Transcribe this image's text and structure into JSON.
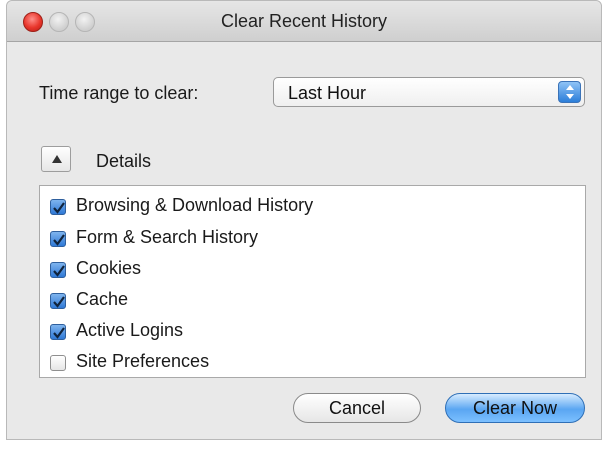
{
  "window": {
    "title": "Clear Recent History"
  },
  "time_range": {
    "label": "Time range to clear:",
    "selected": "Last Hour"
  },
  "details": {
    "label": "Details",
    "expanded": true
  },
  "options": [
    {
      "label": "Browsing & Download History",
      "checked": true
    },
    {
      "label": "Form & Search History",
      "checked": true
    },
    {
      "label": "Cookies",
      "checked": true
    },
    {
      "label": "Cache",
      "checked": true
    },
    {
      "label": "Active Logins",
      "checked": true
    },
    {
      "label": "Site Preferences",
      "checked": false
    }
  ],
  "buttons": {
    "cancel": "Cancel",
    "clear_now": "Clear Now"
  },
  "icons": {
    "close": "close-icon",
    "minimize": "minimize-icon",
    "zoom": "zoom-icon",
    "disclosure": "triangle-up-icon",
    "select": "updown-arrows-icon",
    "check": "checkmark-icon"
  },
  "colors": {
    "accent": "#2f79d6",
    "close": "#e8352b"
  }
}
